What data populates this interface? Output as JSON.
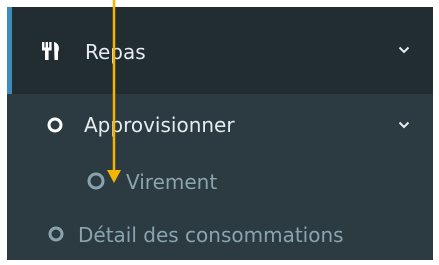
{
  "menu": {
    "repas": {
      "label": "Repas",
      "icon": "cutlery-icon",
      "expanded": true
    },
    "approvisionner": {
      "label": "Approvisionner",
      "icon": "circle-outline-icon",
      "expanded": true
    },
    "virement": {
      "label": "Virement",
      "icon": "circle-outline-icon"
    },
    "detail_consommations": {
      "label": "Détail des consommations",
      "icon": "circle-outline-icon"
    }
  },
  "colors": {
    "sidebar_bg": "#222d32",
    "submenu_bg": "#2c3b41",
    "active_border": "#3c8dbc",
    "text_primary": "#e6ecef",
    "text_muted": "#8aa4af",
    "annotation_arrow": "#f4b400"
  }
}
